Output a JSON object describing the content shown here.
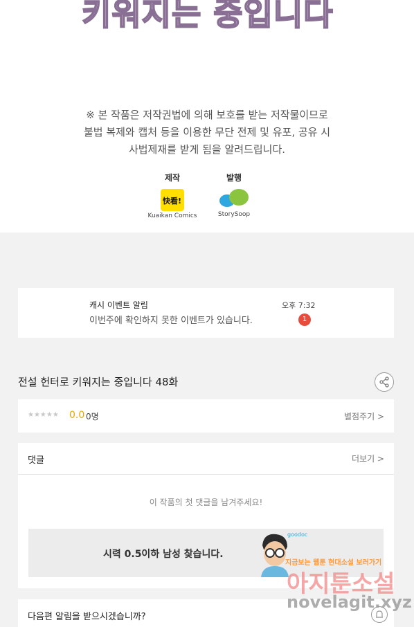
{
  "banner": {
    "title": "키워지는 중입니다",
    "notice_lines": [
      "※ 본 작품은 저작권법에 의해 보호를 받는 저작물이므로",
      "불법 복제와 캡처 등을 이용한 무단 전제 및 유포, 공유 시",
      "사법제재를 받게 됨을 알려드립니다."
    ],
    "credits": [
      {
        "label": "제작",
        "logo_text": "快看!",
        "name": "Kuaikan Comics"
      },
      {
        "label": "발행",
        "logo_text": "",
        "name": "StorySoop"
      }
    ]
  },
  "cash_event": {
    "title": "캐시 이벤트 알림",
    "message": "이번주에 확인하지 못한 이벤트가 있습니다.",
    "time": "오후 7:32",
    "badge": "1"
  },
  "episode": {
    "title": "전설 헌터로 키워지는 중입니다 48화"
  },
  "rating": {
    "stars": "★★★★★",
    "score": "0.0",
    "count": "0명",
    "rate_label": "별점주기 >"
  },
  "comments": {
    "header": "댓글",
    "more_label": "더보기 >",
    "empty_message": "이 작품의 첫 댓글을 남겨주세요!"
  },
  "ad": {
    "text": "시력 0.5이하 남성 찾습니다.",
    "brand": "goodoc"
  },
  "next_notify": {
    "question": "다음편 알림을 받으시겠습니까?"
  },
  "watermark": {
    "line1": "지금보는 웹툰 현대소설 보러가기",
    "line2": "아지툰소설",
    "line3": "novelagit.xyz"
  },
  "colors": {
    "accent_score": "#e6a800",
    "badge": "#e74c3c"
  }
}
